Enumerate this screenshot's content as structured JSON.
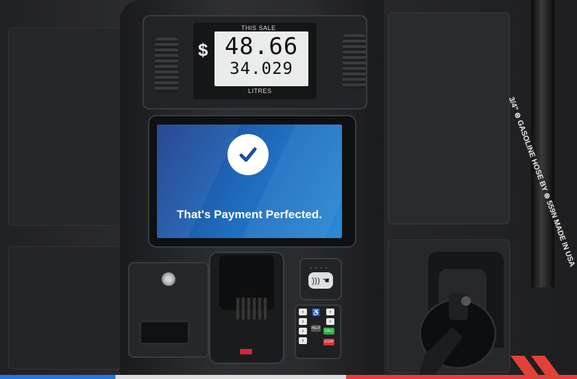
{
  "display": {
    "sale_label": "THIS SALE",
    "currency_symbol": "$",
    "amount": "48.66",
    "volume": "34.029",
    "unit_label": "LITRES"
  },
  "screen": {
    "tagline": "That's Payment Perfected.",
    "icon": "check-icon"
  },
  "keypad": {
    "help": "HELP",
    "call": "CALL",
    "stop": "STOP"
  },
  "hose": {
    "imprint": "3/4\" ⊗ GASOLINE HOSE BY ⊗ 559N MADE IN USA"
  },
  "colors": {
    "screen_blue": "#1f6fc0",
    "accent_red": "#e2413a",
    "accent_blue": "#2277dd",
    "led_green": "#36d36a"
  }
}
